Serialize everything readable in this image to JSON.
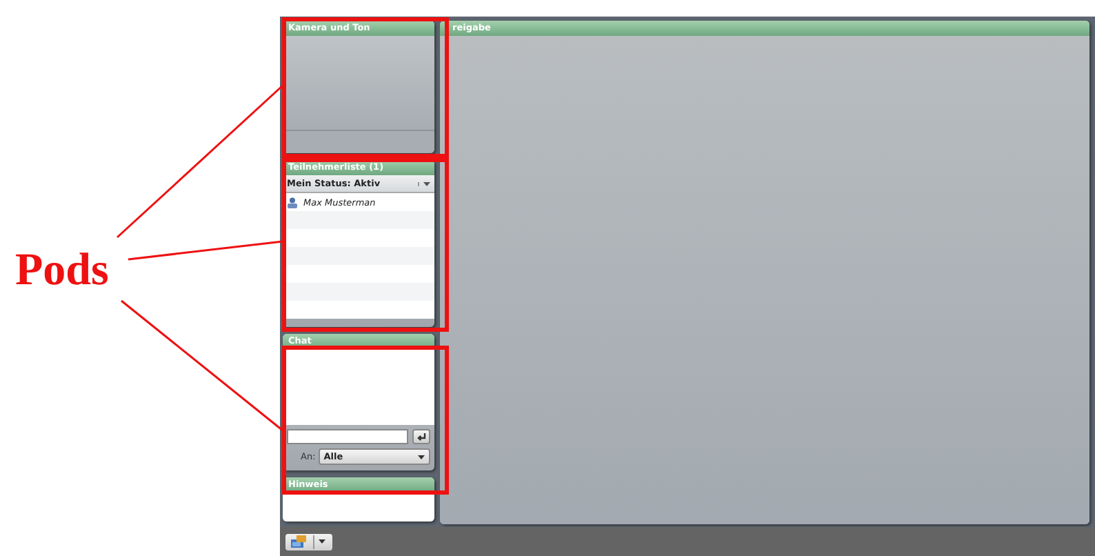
{
  "annotation": {
    "label": "Pods"
  },
  "pods": [
    {
      "kind": "camera",
      "title": "Kamera und Ton"
    },
    {
      "kind": "attendees",
      "title": "Teilnehmerliste (1)",
      "status": "Mein Status: Aktiv",
      "attendees": [
        "Max Musterman"
      ]
    },
    {
      "kind": "chat",
      "title": "Chat",
      "to_label": "An:",
      "to_value": "Alle"
    },
    {
      "kind": "notes",
      "title": "Hinweis"
    }
  ],
  "share_pod": {
    "title": "reigabe"
  }
}
